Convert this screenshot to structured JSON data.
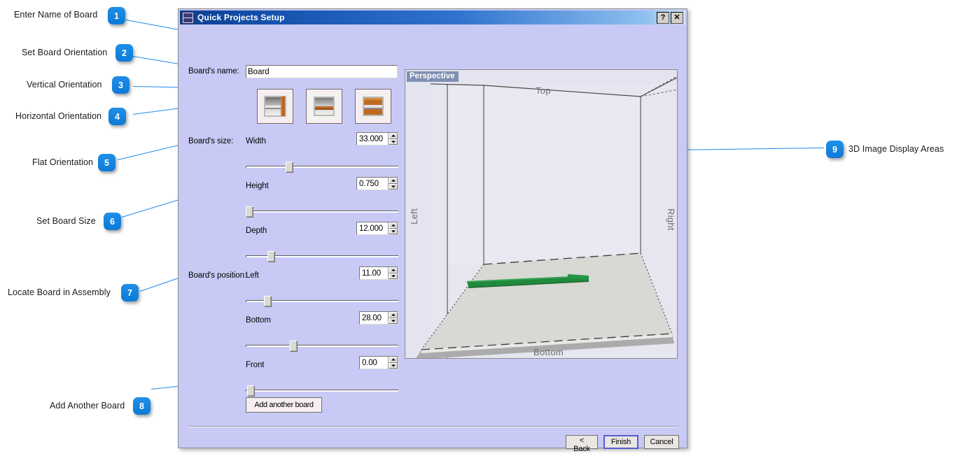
{
  "annotations": [
    {
      "num": "1",
      "label": "Enter Name of Board"
    },
    {
      "num": "2",
      "label": "Set Board Orientation"
    },
    {
      "num": "3",
      "label": "Vertical Orientation"
    },
    {
      "num": "4",
      "label": "Horizontal Orientation"
    },
    {
      "num": "5",
      "label": "Flat Orientation"
    },
    {
      "num": "6",
      "label": "Set Board Size"
    },
    {
      "num": "7",
      "label": "Locate Board in Assembly"
    },
    {
      "num": "8",
      "label": "Add Another Board"
    },
    {
      "num": "9",
      "label": "3D Image Display Areas"
    }
  ],
  "dialog": {
    "title": "Quick Projects Setup",
    "window_icon": "app-icon",
    "help_button": "?",
    "close_button": "✕",
    "name_label": "Board's name:",
    "name_value": "Board",
    "name_placeholder": "Board",
    "orientations": [
      {
        "name": "vertical",
        "selected": true
      },
      {
        "name": "horizontal",
        "selected": false
      },
      {
        "name": "flat",
        "selected": false
      }
    ],
    "size_label": "Board's size:",
    "position_label": "Board's position:",
    "fields": [
      {
        "key": "width",
        "label": "Width",
        "value": "33.000",
        "slider_pct": 22
      },
      {
        "key": "height",
        "label": "Height",
        "value": "0.750",
        "slider_pct": 1
      },
      {
        "key": "depth",
        "label": "Depth",
        "value": "12.000",
        "slider_pct": 14
      },
      {
        "key": "left",
        "label": "Left",
        "value": "11.00",
        "slider_pct": 12
      },
      {
        "key": "bottom",
        "label": "Bottom",
        "value": "28.00",
        "slider_pct": 29
      },
      {
        "key": "front",
        "label": "Front",
        "value": "0.00",
        "slider_pct": 1
      }
    ],
    "add_board_label": "Add another board",
    "footer_buttons": [
      {
        "key": "back",
        "label": "< Back",
        "default": false
      },
      {
        "key": "finish",
        "label": "Finish",
        "default": true
      },
      {
        "key": "cancel",
        "label": "Cancel",
        "default": false
      }
    ]
  },
  "viewport": {
    "mode_tag": "Perspective",
    "labels": {
      "top": "Top",
      "bottom": "Bottom",
      "left": "Left",
      "right": "Right"
    },
    "board_color": "#1f8a3c",
    "floor_color": "#d8d8d4"
  },
  "colors": {
    "accent": "#1383e0",
    "dialog_bg": "#c8caf5",
    "title_start": "#0b3d91",
    "title_end": "#cfe3f8",
    "viewport_bg": "#e4e4f0"
  }
}
